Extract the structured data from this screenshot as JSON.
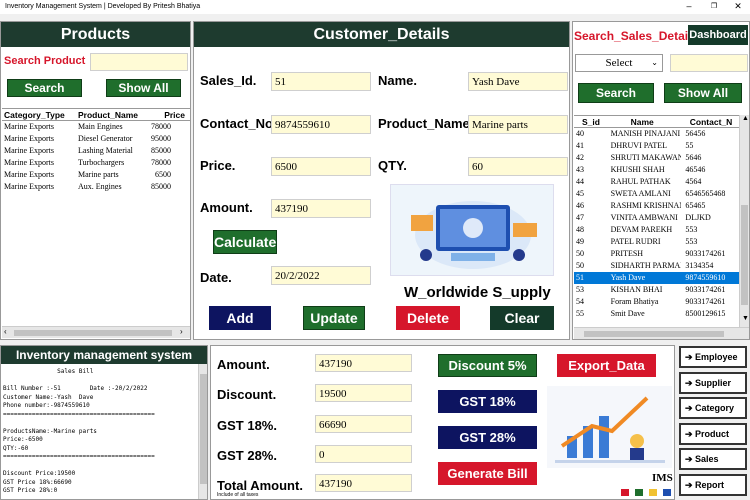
{
  "window": {
    "title": "Inventory Management System | Developed By Pritesh Bhatiya",
    "minimize": "–",
    "maximize": "❐",
    "close": "✕"
  },
  "products": {
    "header": "Products",
    "search_label": "Search Product",
    "search_value": "",
    "search_btn": "Search",
    "show_all_btn": "Show All",
    "columns": [
      "Category_Type",
      "Product_Name",
      "Price"
    ],
    "rows": [
      [
        "Marine Exports",
        "Main Engines",
        "78000"
      ],
      [
        "Marine Exports",
        "Diesel Generator",
        "95000"
      ],
      [
        "Marine Exports",
        "Lashing Material",
        "85000"
      ],
      [
        "Marine Exports",
        "Turbochargers",
        "78000"
      ],
      [
        "Marine Exports",
        "Marine parts",
        "6500"
      ],
      [
        "Marine Exports",
        "Aux. Engines",
        "85000"
      ]
    ]
  },
  "customer": {
    "header": "Customer_Details",
    "sales_id_label": "Sales_Id.",
    "sales_id": "51",
    "name_label": "Name.",
    "name": "Yash  Dave",
    "contact_label": "Contact_No.",
    "contact": "9874559610",
    "product_label": "Product_Name.",
    "product": "Marine parts",
    "price_label": "Price.",
    "price": "6500",
    "qty_label": "QTY.",
    "qty": "60",
    "amount_label": "Amount.",
    "amount": "437190",
    "calculate_btn": "Calculate",
    "date_label": "Date.",
    "date": "20/2/2022",
    "brand": "W_orldwide S_upply",
    "add_btn": "Add",
    "update_btn": "Update",
    "delete_btn": "Delete",
    "clear_btn": "Clear"
  },
  "sales": {
    "header": "Search_Sales_Detail",
    "dashboard_btn": "Dashboard",
    "select_value": "Select",
    "search_btn": "Search",
    "show_all_btn": "Show All",
    "columns": [
      "S_id",
      "Name",
      "Contact_N"
    ],
    "rows": [
      [
        "40",
        "MANISH PINAJANI",
        "56456"
      ],
      [
        "41",
        "DHRUVI PATEL",
        "55"
      ],
      [
        "42",
        "SHRUTI MAKAWAN",
        "5646"
      ],
      [
        "43",
        "KHUSHI SHAH",
        "46546"
      ],
      [
        "44",
        "RAHUL PATHAK",
        "4564"
      ],
      [
        "45",
        "SWETA AMLANI",
        "6546565468"
      ],
      [
        "46",
        "RASHMI KRISHNAN",
        "65465"
      ],
      [
        "47",
        "VINITA AMBWANI",
        "DLJKD"
      ],
      [
        "48",
        "DEVAM PAREKH",
        "553"
      ],
      [
        "49",
        "PATEL RUDRI",
        "553"
      ],
      [
        "50",
        "PRITESH",
        "9033174261"
      ],
      [
        "50",
        "SIDHARTH PARMAR",
        "3134354"
      ],
      [
        "51",
        "Yash  Dave",
        "9874559610"
      ],
      [
        "53",
        "KISHAN BHAI",
        "9033174261"
      ],
      [
        "54",
        "Foram Bhatiya",
        "9033174261"
      ],
      [
        "55",
        "Smit Dave",
        "8500129615"
      ]
    ],
    "selected_index": 12
  },
  "bill": {
    "header": "Inventory management system",
    "lines": [
      "               Sales Bill",
      "",
      "Bill Number :-51        Date :-20/2/2022",
      "Customer Name:-Yash  Dave",
      "Phone number:-9874559610",
      "==========================================",
      "",
      "ProductsName:-Marine parts",
      "Price:-6500",
      "QTY:-60",
      "==========================================",
      "",
      "Discount Price:19500",
      "GST Price 18%:66690",
      "GST Price 28%:0"
    ]
  },
  "billing": {
    "amount_label": "Amount.",
    "amount": "437190",
    "discount_label": "Discount.",
    "discount": "19500",
    "gst18_label": "GST 18%.",
    "gst18": "66690",
    "gst28_label": "GST 28%.",
    "gst28": "0",
    "total_label": "Total  Amount.",
    "total": "437190",
    "total_note": "Include of all taxes",
    "discount_btn": "Discount 5%",
    "export_btn": "Export_Data",
    "gst18_btn": "GST 18%",
    "gst28_btn": "GST 28%",
    "generate_btn": "Generate Bill",
    "ims_logo": "IMS"
  },
  "nav": [
    {
      "label": "Employee"
    },
    {
      "label": "Supplier"
    },
    {
      "label": "Category"
    },
    {
      "label": "Product"
    },
    {
      "label": "Sales"
    },
    {
      "label": "Report"
    }
  ],
  "colors": {
    "panel_header": "#1e3b2f",
    "accent_red": "#d6162b",
    "navy": "#0d1460",
    "field_bg": "#fffbd6",
    "selection": "#0078d7"
  }
}
